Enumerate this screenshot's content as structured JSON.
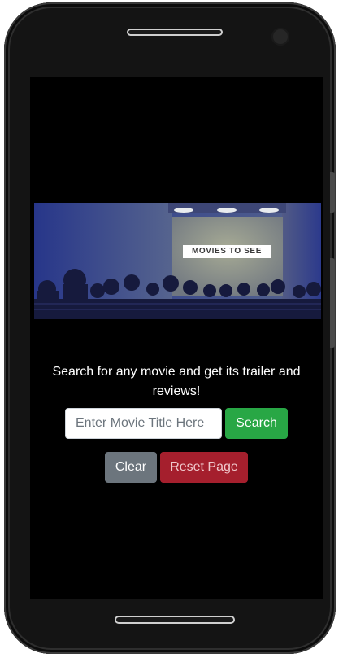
{
  "hero": {
    "badge_text": "MOVIES TO SEE"
  },
  "main": {
    "tagline": "Search for any movie and get its trailer and reviews!"
  },
  "search": {
    "placeholder": "Enter Movie Title Here",
    "value": "",
    "button_label": "Search"
  },
  "actions": {
    "clear_label": "Clear",
    "reset_label": "Reset Page"
  },
  "colors": {
    "search_button": "#28a745",
    "clear_button": "#6c757d",
    "reset_button": "#a51f2d",
    "screen_background": "#000000"
  },
  "icons": {
    "front_camera": "camera-icon",
    "top_speaker": "speaker-icon",
    "bottom_speaker": "speaker-icon"
  }
}
